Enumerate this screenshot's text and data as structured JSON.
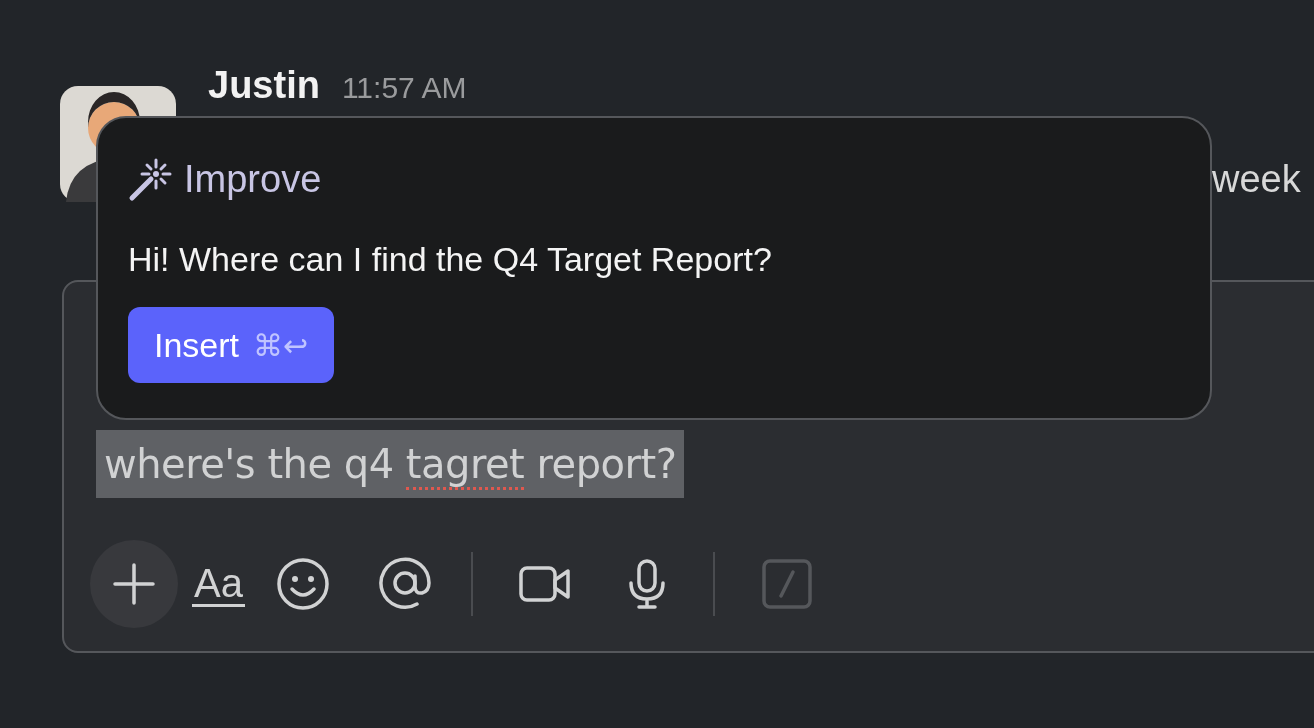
{
  "message": {
    "author": "Justin",
    "time": "11:57 AM",
    "text": "week"
  },
  "composer": {
    "selected": true,
    "draft": [
      {
        "text": "where's the q4 ",
        "misspelled": false
      },
      {
        "text": "tagret",
        "misspelled": true
      },
      {
        "text": " report?",
        "misspelled": false
      }
    ],
    "toolbar": [
      {
        "kind": "plus",
        "disabled": false
      },
      {
        "kind": "format",
        "label": "Aa",
        "disabled": false
      },
      {
        "kind": "emoji",
        "disabled": false
      },
      {
        "kind": "mention",
        "disabled": false
      },
      {
        "kind": "divider"
      },
      {
        "kind": "video",
        "disabled": false
      },
      {
        "kind": "mic",
        "disabled": false
      },
      {
        "kind": "divider"
      },
      {
        "kind": "slash",
        "disabled": true
      }
    ]
  },
  "popup": {
    "title": "Improve",
    "suggestion": "Hi! Where can I find the Q4 Target Report?",
    "button": {
      "label": "Insert",
      "shortcut": "⌘↩"
    }
  }
}
